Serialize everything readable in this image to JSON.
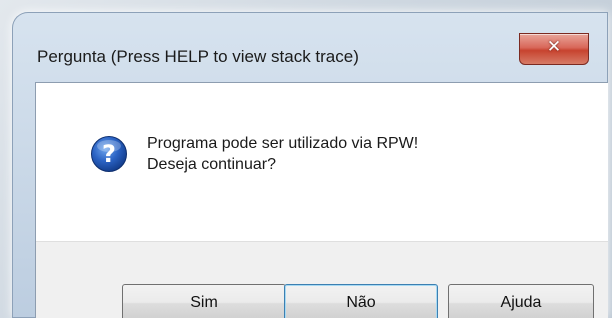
{
  "window": {
    "title": "Pergunta (Press HELP to view stack trace)",
    "close_icon": "close-icon",
    "close_glyph": "✕"
  },
  "message": {
    "icon": "question-icon",
    "line1": "Programa pode ser utilizado via RPW!",
    "line2": "Deseja continuar?"
  },
  "buttons": {
    "sim": "Sim",
    "nao": "Não",
    "ajuda": "Ajuda"
  },
  "colors": {
    "icon_blue": "#2b63c4",
    "close_red": "#c7432f",
    "default_button_border": "#3c7fb1"
  }
}
